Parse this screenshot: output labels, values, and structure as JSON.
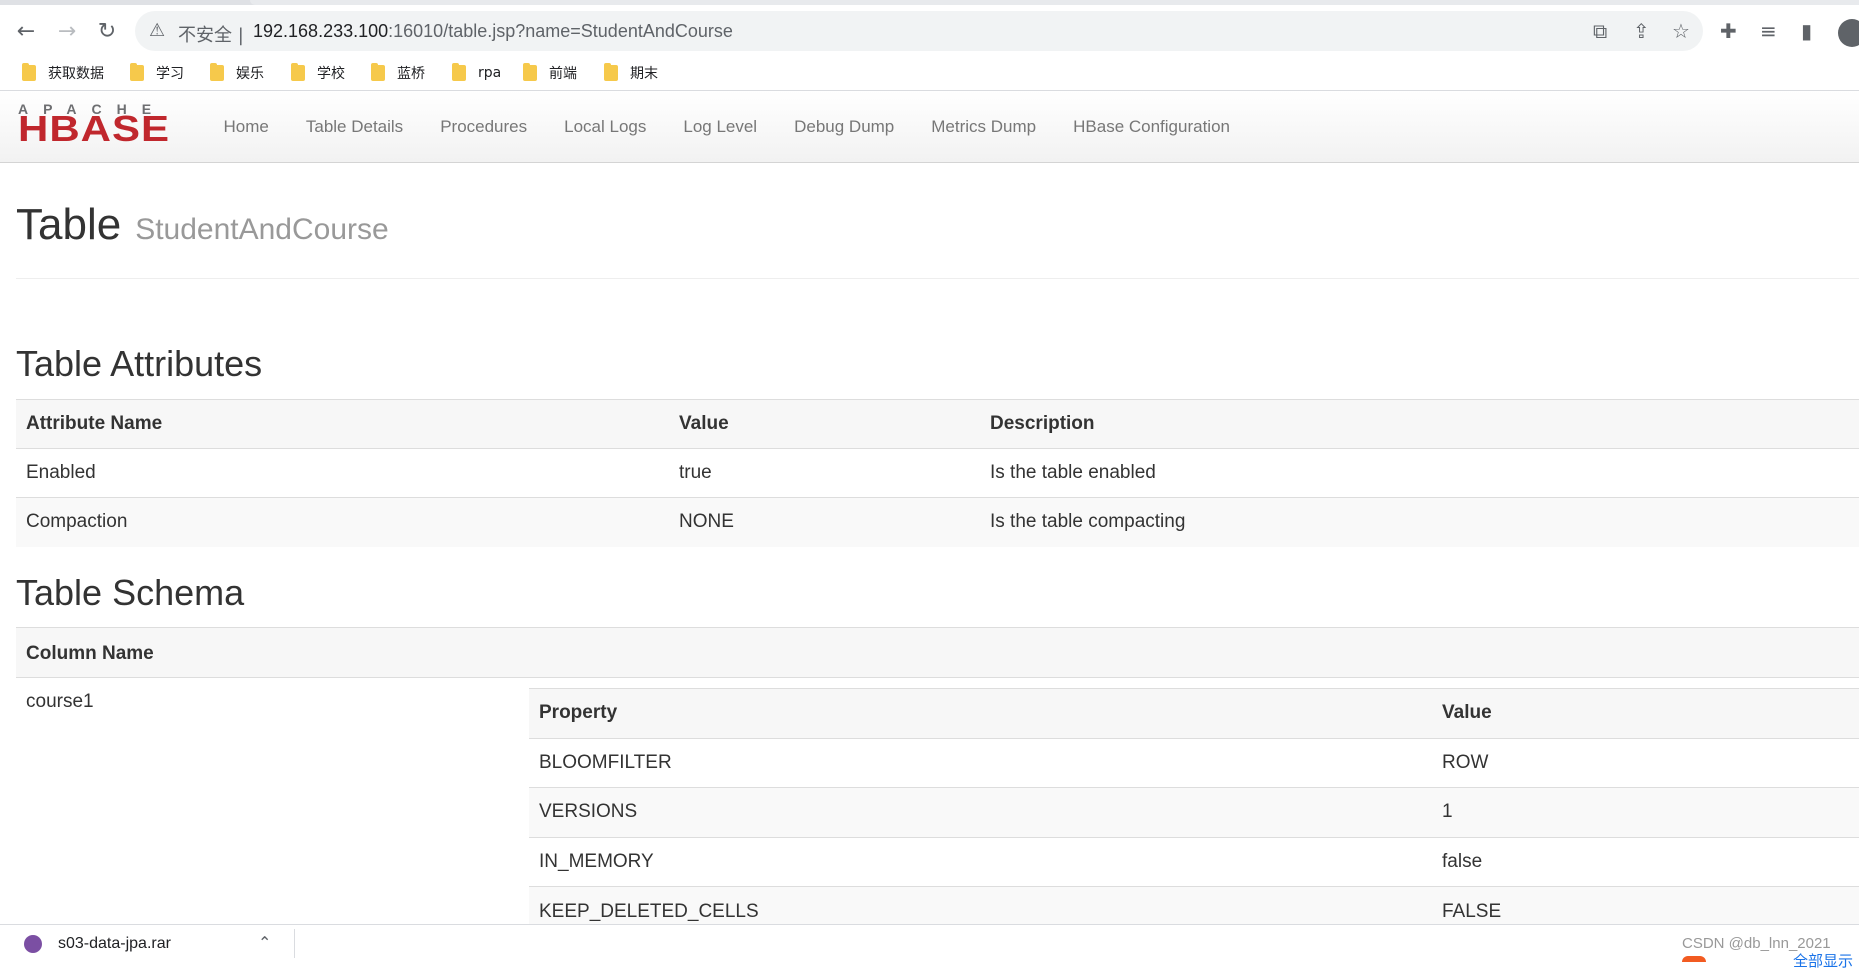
{
  "browser": {
    "insecure_label": "不安全",
    "url_host": "192.168.233.100",
    "url_rest": ":16010/table.jsp?name=StudentAndCourse",
    "bookmarks": [
      "获取数据",
      "学习",
      "娱乐",
      "学校",
      "蓝桥",
      "rpa",
      "前端",
      "期末"
    ]
  },
  "navbar": {
    "logo_top": "APACHE",
    "logo_main": "HBASE",
    "links": [
      "Home",
      "Table Details",
      "Procedures",
      "Local Logs",
      "Log Level",
      "Debug Dump",
      "Metrics Dump",
      "HBase Configuration"
    ]
  },
  "page": {
    "title": "Table",
    "subtitle": "StudentAndCourse"
  },
  "attributes": {
    "heading": "Table Attributes",
    "columns": [
      "Attribute Name",
      "Value",
      "Description"
    ],
    "rows": [
      [
        "Enabled",
        "true",
        "Is the table enabled"
      ],
      [
        "Compaction",
        "NONE",
        "Is the table compacting"
      ]
    ]
  },
  "schema": {
    "heading": "Table Schema",
    "column_header": "Column Name",
    "column_name": "course1",
    "prop_columns": [
      "Property",
      "Value"
    ],
    "props": [
      [
        "BLOOMFILTER",
        "ROW"
      ],
      [
        "VERSIONS",
        "1"
      ],
      [
        "IN_MEMORY",
        "false"
      ],
      [
        "KEEP_DELETED_CELLS",
        "FALSE"
      ]
    ]
  },
  "download": {
    "filename": "s03-data-jpa.rar",
    "show_all": "全部显示"
  },
  "watermark": "CSDN @db_lnn_2021"
}
